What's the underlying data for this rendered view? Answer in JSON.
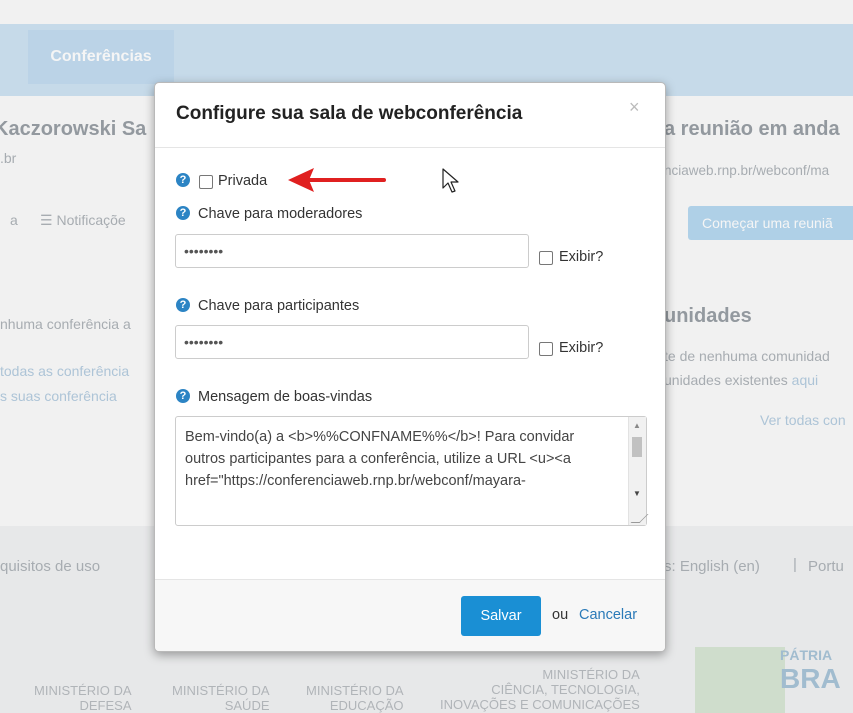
{
  "background": {
    "tab_label": "Conferências",
    "user_name": "Kaczorowski Sa",
    "email_suffix": ".br",
    "menu_left": "a",
    "menu_notifications": "Notificaçõe",
    "meeting_title": "a reunião em anda",
    "meeting_url": "nciaweb.rnp.br/webconf/ma",
    "start_button": "Começar uma reuniã",
    "no_conf": "nhuma conferência a",
    "all_conf": "todas as conferência",
    "your_conf": "s suas conferência",
    "communities_title": "unidades",
    "no_community": "te de nenhuma comunidad",
    "existing_communities": "unidades existentes",
    "here_link": "aqui",
    "see_all": "Ver todas con",
    "terms": "quisitos de uso",
    "language": "s: English (en)",
    "lang_sep": "|",
    "language2": "Portu",
    "logo1_line1": "MINISTÉRIO DA",
    "logo1_line2": "DEFESA",
    "logo2_line1": "MINISTÉRIO DA",
    "logo2_line2": "SAÚDE",
    "logo3_line1": "MINISTÉRIO DA",
    "logo3_line2": "EDUCAÇÃO",
    "logo4_line1": "MINISTÉRIO DA",
    "logo4_line2": "CIÊNCIA, TECNOLOGIA,",
    "logo4_line3": "INOVAÇÕES E COMUNICAÇÕES",
    "patria_line1": "PÁTRIA",
    "patria_line2": "BRA"
  },
  "modal": {
    "title": "Configure sua sala de webconferência",
    "close": "×",
    "help_glyph": "?",
    "private_label": "Privada",
    "moderator_label": "Chave para moderadores",
    "moderator_value": "••••••••",
    "show_label": "Exibir?",
    "participant_label": "Chave para participantes",
    "participant_value": "••••••••",
    "welcome_label": "Mensagem de boas-vindas",
    "welcome_text": "Bem-vindo(a) a <b>%%CONFNAME%%</b>! Para convidar outros participantes para a conferência, utilize a URL <u><a href=\"https://conferenciaweb.rnp.br/webconf/mayara-",
    "save_label": "Salvar",
    "or_label": "ou",
    "cancel_label": "Cancelar"
  },
  "colors": {
    "primary": "#1a8fd4",
    "help_icon": "#2c84c4",
    "arrow": "#e02020"
  },
  "icons": {
    "help": "help-circle-icon",
    "close": "close-icon",
    "arrow": "red-arrow-icon",
    "cursor": "mouse-cursor-icon"
  }
}
